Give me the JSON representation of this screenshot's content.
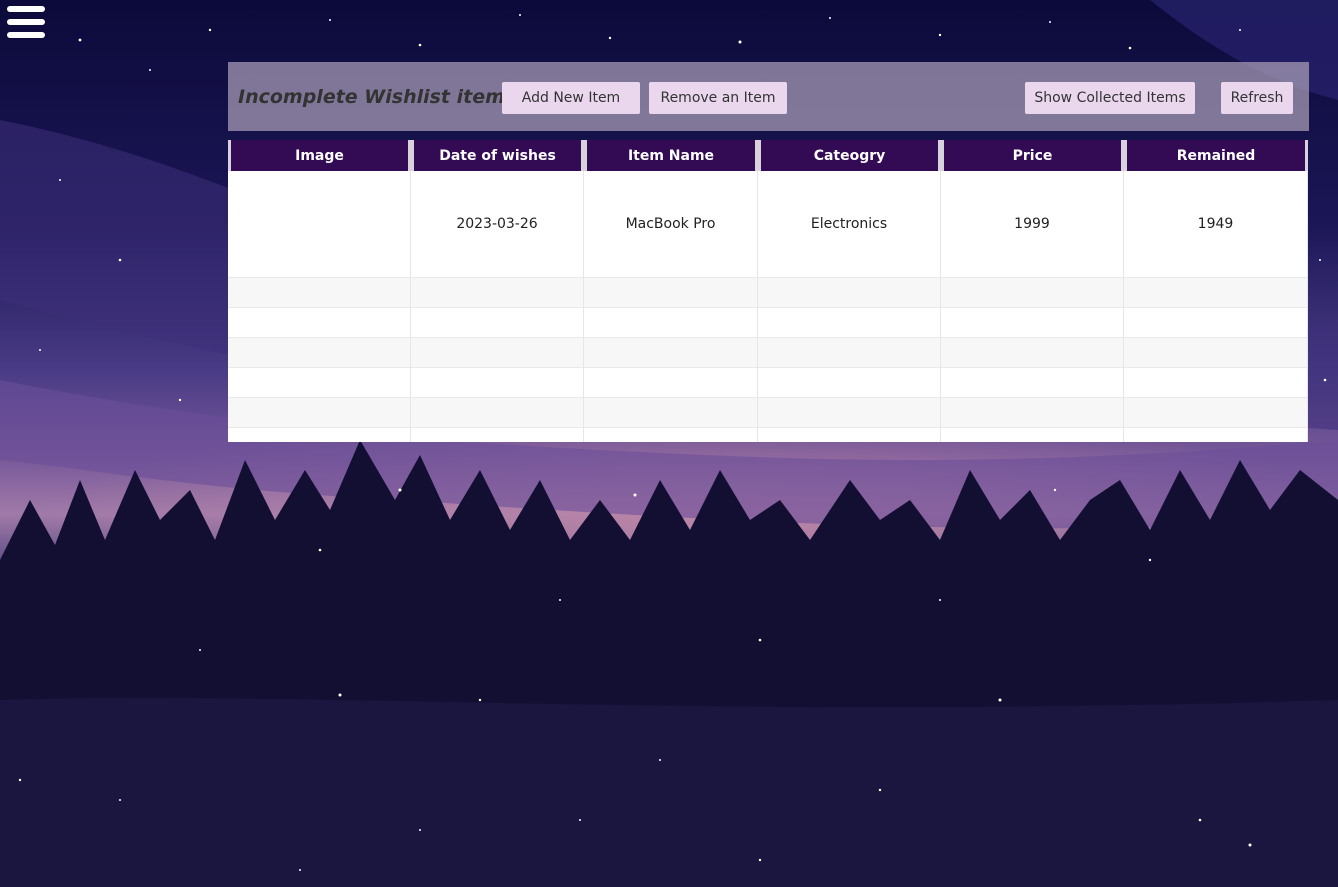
{
  "toolbar": {
    "title": "Incomplete Wishlist items",
    "add_label": "Add New Item",
    "remove_label": "Remove an Item",
    "show_collected_label": "Show Collected Items",
    "refresh_label": "Refresh"
  },
  "table": {
    "headers": [
      "Image",
      "Date of wishes",
      "Item Name",
      "Cateogry",
      "Price",
      "Remained"
    ],
    "rows": [
      {
        "image": "",
        "date": "2023-03-26",
        "name": "MacBook Pro",
        "category": "Electronics",
        "price": "1999",
        "remained": "1949"
      }
    ]
  },
  "colors": {
    "header_bg": "#330b55",
    "button_bg": "#ead7ee",
    "toolbar_bg": "#aaa0b9"
  },
  "icons": {
    "menu": "hamburger-menu-icon"
  }
}
